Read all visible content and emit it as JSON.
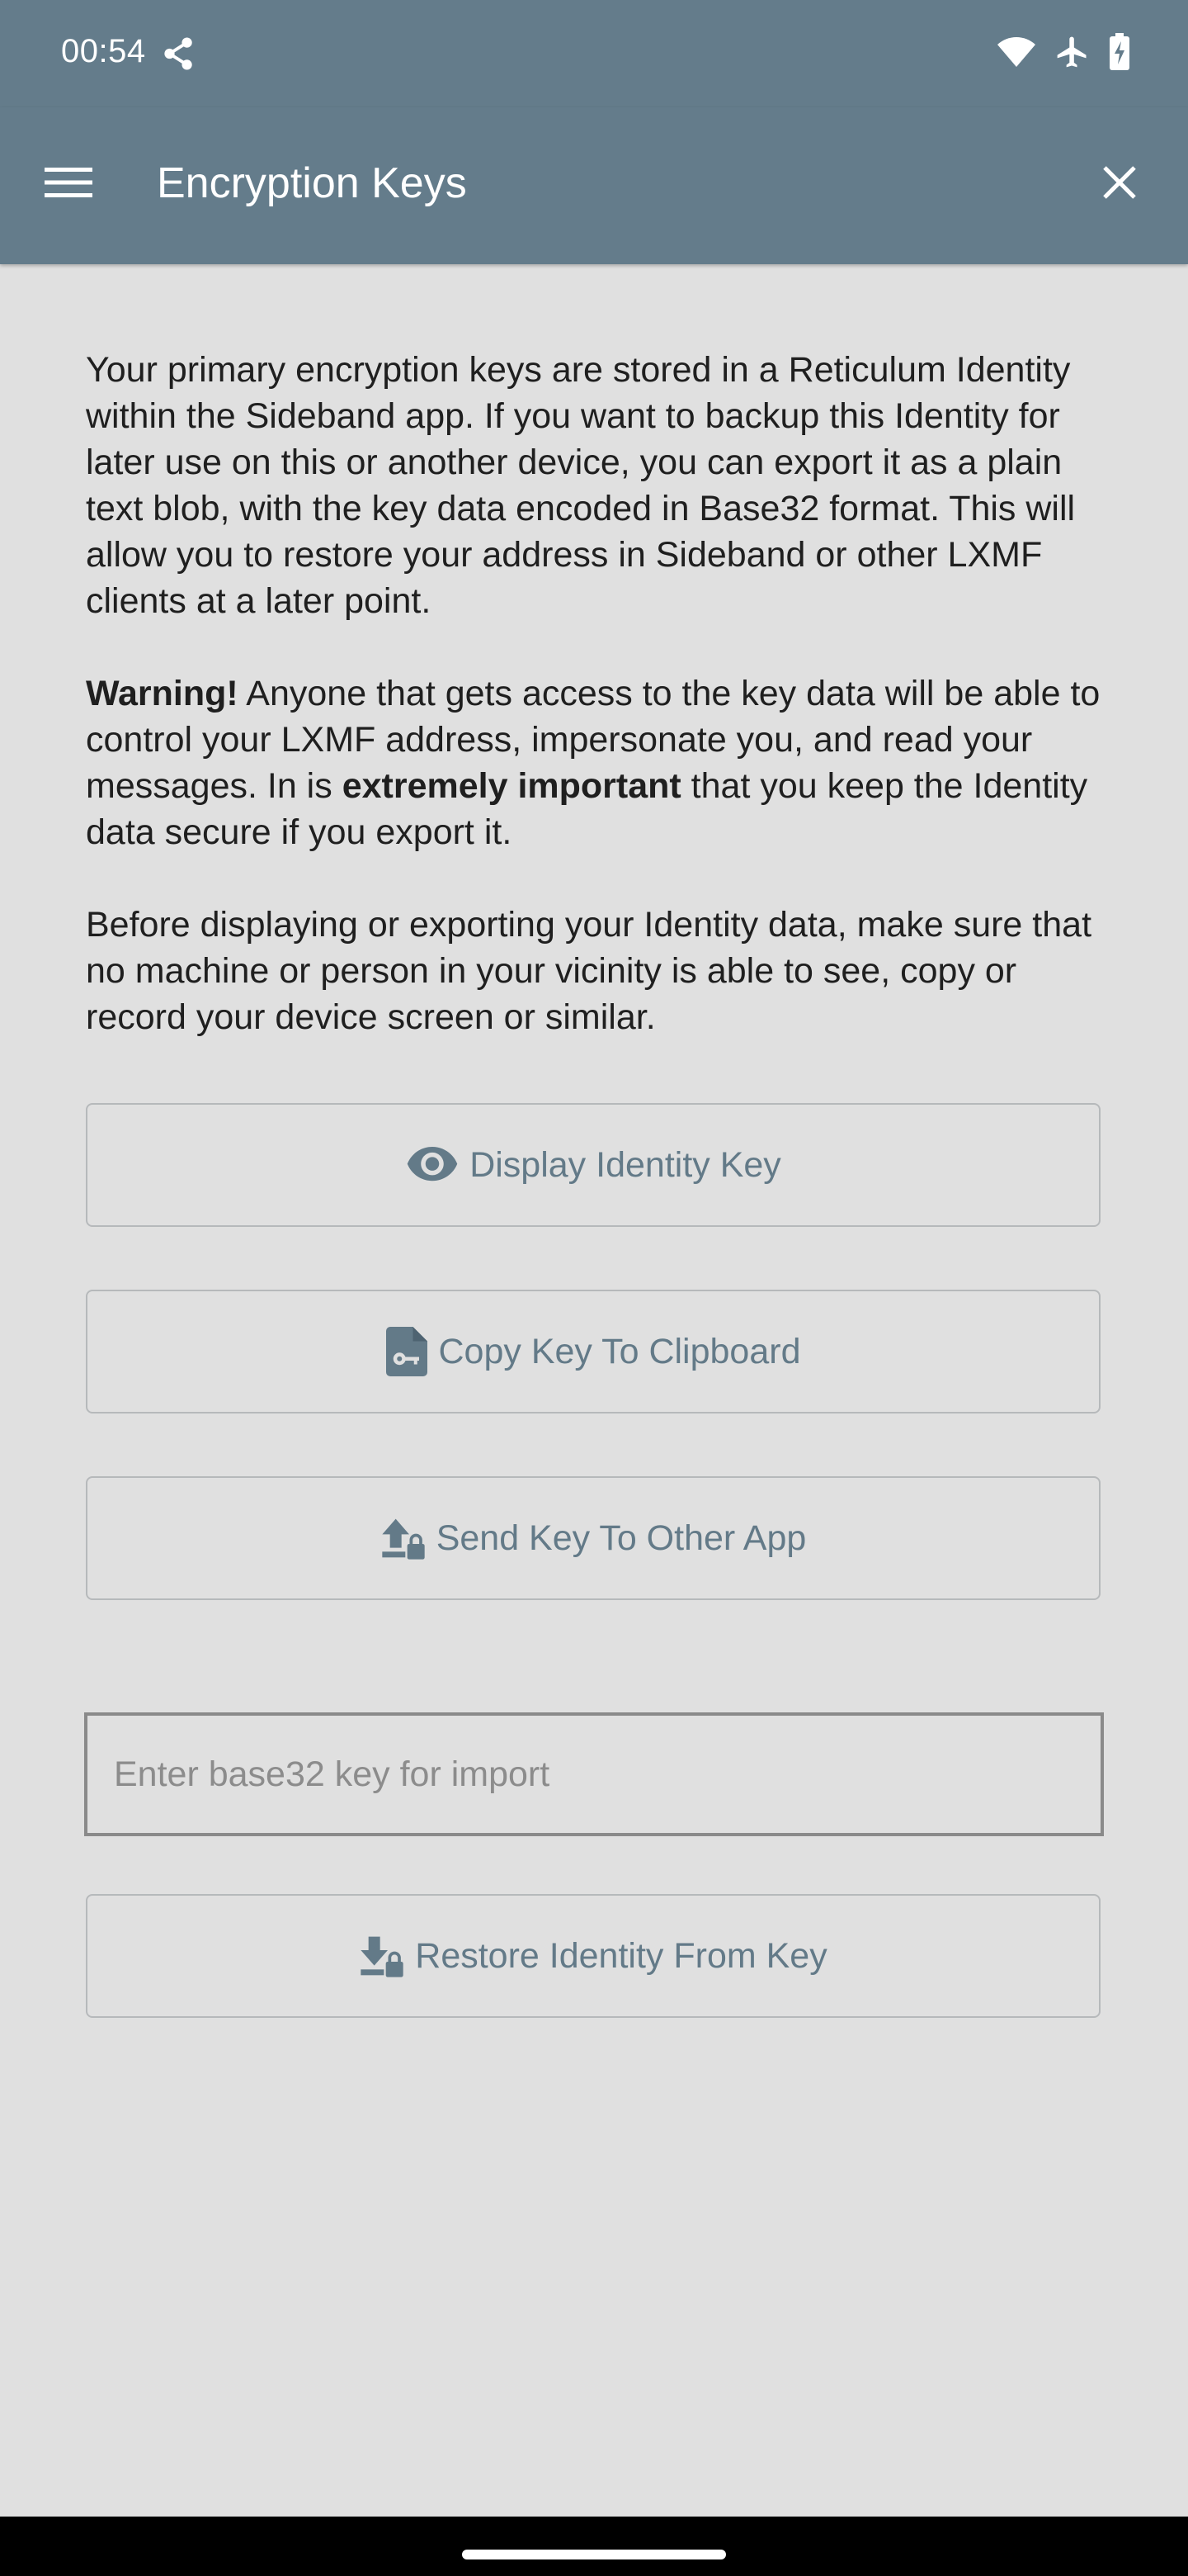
{
  "status_bar": {
    "time": "00:54",
    "icons": [
      "share-network-icon",
      "wifi-icon",
      "airplane-icon",
      "battery-icon"
    ]
  },
  "app_bar": {
    "title": "Encryption Keys",
    "menu_icon": "hamburger-menu-icon",
    "close_icon": "close-icon",
    "background_color": "#647c8b"
  },
  "content": {
    "intro": "Your primary encryption keys are stored in a Reticulum Identity within the Sideband app. If you want to backup this Identity for later use on this or another device, you can export it as a plain text blob, with the key data encoded in Base32 format. This will allow you to restore your address in Sideband or other LXMF clients at a later point.",
    "warning_label": "Warning!",
    "warning_text_1": " Anyone that gets access to the key data will be able to control your LXMF address, impersonate you, and read your messages. In is ",
    "warning_emphasis": "extremely important",
    "warning_text_2": " that you keep the Identity data secure if you export it.",
    "caution": "Before displaying or exporting your Identity data, make sure that no machine or person in your vicinity is able to see, copy or record your device screen or similar."
  },
  "buttons": {
    "display_key": {
      "label": "Display Identity Key",
      "icon": "eye-icon"
    },
    "copy_key": {
      "label": "Copy Key To Clipboard",
      "icon": "file-key-icon"
    },
    "send_key": {
      "label": "Send Key To Other App",
      "icon": "upload-lock-icon"
    },
    "restore_key": {
      "label": "Restore Identity From Key",
      "icon": "download-lock-icon"
    }
  },
  "import_field": {
    "placeholder": "Enter base32 key for import",
    "value": ""
  },
  "colors": {
    "accent": "#637a88",
    "background": "#e0e0e0"
  }
}
